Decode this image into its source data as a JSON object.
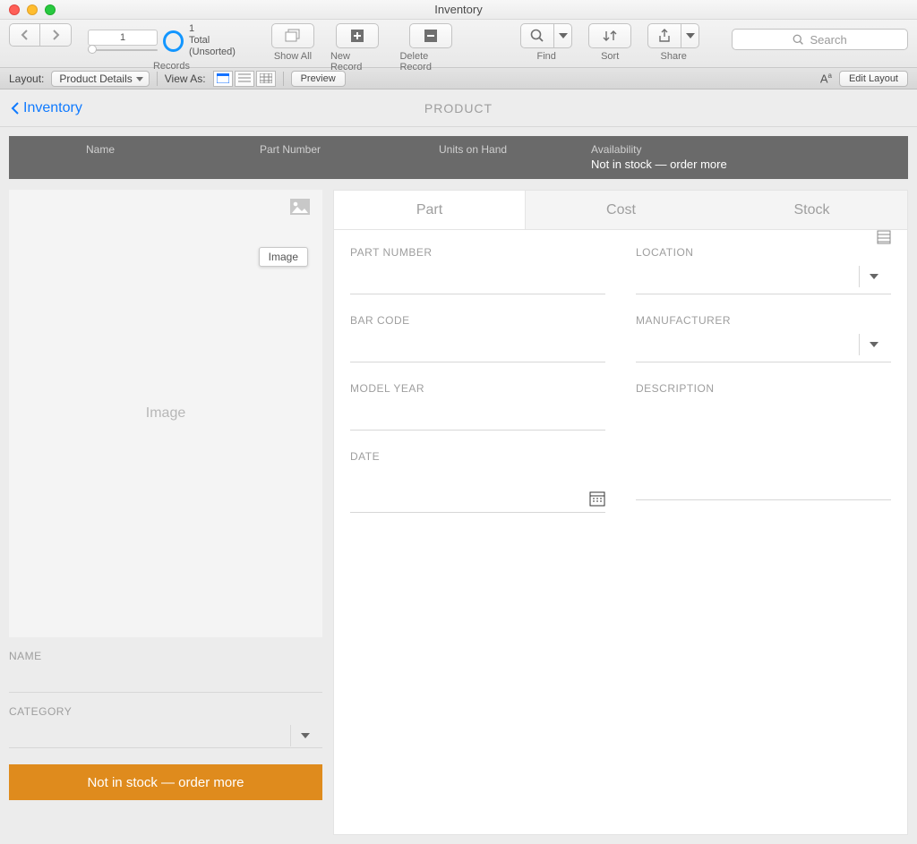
{
  "window": {
    "title": "Inventory"
  },
  "toolbar": {
    "records_label": "Records",
    "record_current": "1",
    "record_total_line1": "1",
    "record_total_line2": "Total (Unsorted)",
    "show_all": "Show All",
    "new_record": "New Record",
    "delete_record": "Delete Record",
    "find": "Find",
    "sort": "Sort",
    "share": "Share",
    "search_placeholder": "Search"
  },
  "layoutbar": {
    "layout_label": "Layout:",
    "layout_value": "Product Details",
    "view_as_label": "View As:",
    "preview": "Preview",
    "edit_layout": "Edit Layout"
  },
  "breadcrumb": {
    "back": "Inventory",
    "center": "PRODUCT"
  },
  "banner": {
    "name_label": "Name",
    "part_label": "Part Number",
    "units_label": "Units on Hand",
    "avail_label": "Availability",
    "avail_value": "Not in stock — order more"
  },
  "left": {
    "image_placeholder": "Image",
    "image_tooltip": "Image",
    "name_label": "NAME",
    "category_label": "CATEGORY",
    "stock_btn": "Not in stock — order more"
  },
  "tabs": {
    "part": "Part",
    "cost": "Cost",
    "stock": "Stock"
  },
  "form": {
    "part_number": "PART NUMBER",
    "bar_code": "BAR CODE",
    "model_year": "MODEL YEAR",
    "date": "DATE",
    "location": "LOCATION",
    "manufacturer": "MANUFACTURER",
    "description": "DESCRIPTION"
  }
}
